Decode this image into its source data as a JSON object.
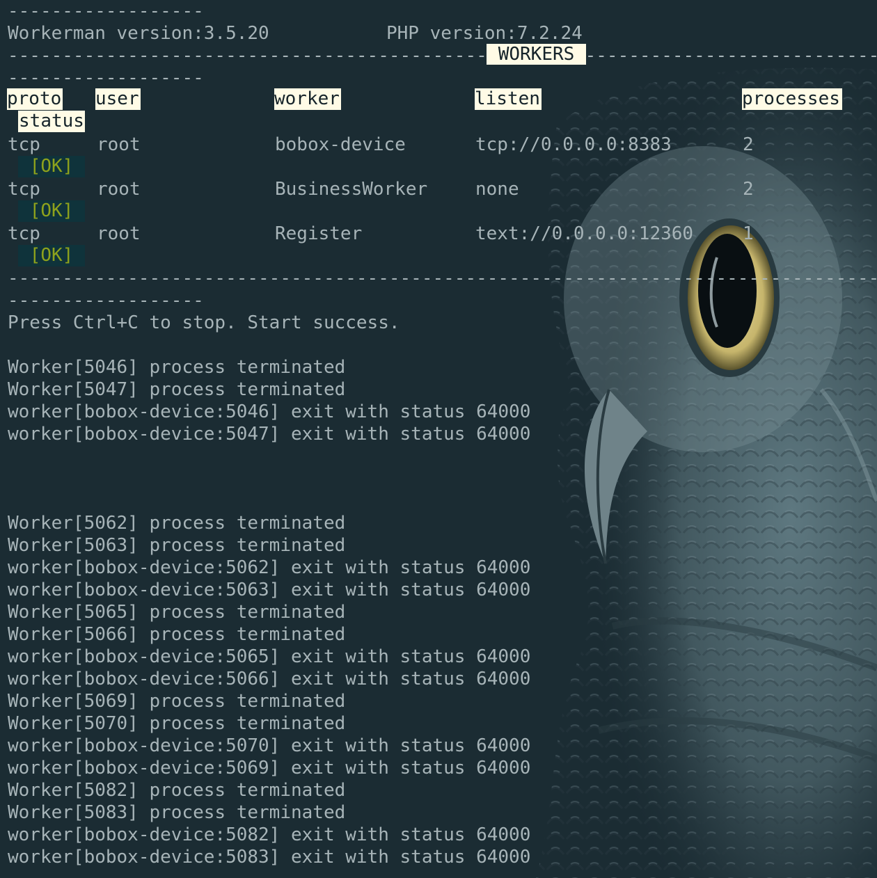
{
  "header": {
    "top_dashes": "------------------",
    "workerman_version": "Workerman version:3.5.20",
    "php_version": "PHP version:7.2.24",
    "workers_title": "WORKERS",
    "after_title_dashes": "------------------"
  },
  "table": {
    "columns": {
      "proto": "proto",
      "user": "user",
      "worker": "worker",
      "listen": "listen",
      "processes": "processes",
      "status": "status"
    },
    "rows": [
      {
        "proto": "tcp",
        "user": "root",
        "worker": "bobox-device",
        "listen": "tcp://0.0.0.0:8383",
        "processes": "2",
        "status": "[OK]"
      },
      {
        "proto": "tcp",
        "user": "root",
        "worker": "BusinessWorker",
        "listen": "none",
        "processes": "2",
        "status": "[OK]"
      },
      {
        "proto": "tcp",
        "user": "root",
        "worker": "Register",
        "listen": "text://0.0.0.0:12360",
        "processes": "1",
        "status": "[OK]"
      }
    ],
    "bottom_dashes": "------------------"
  },
  "start_message": "Press Ctrl+C to stop. Start success.",
  "log_block_1": [
    "Worker[5046] process terminated",
    "Worker[5047] process terminated",
    "worker[bobox-device:5046] exit with status 64000",
    "worker[bobox-device:5047] exit with status 64000"
  ],
  "log_block_2": [
    "Worker[5062] process terminated",
    "Worker[5063] process terminated",
    "worker[bobox-device:5062] exit with status 64000",
    "worker[bobox-device:5063] exit with status 64000",
    "Worker[5065] process terminated",
    "Worker[5066] process terminated",
    "worker[bobox-device:5065] exit with status 64000",
    "worker[bobox-device:5066] exit with status 64000",
    "Worker[5069] process terminated",
    "Worker[5070] process terminated",
    "worker[bobox-device:5070] exit with status 64000",
    "worker[bobox-device:5069] exit with status 64000",
    "Worker[5082] process terminated",
    "Worker[5083] process terminated",
    "worker[bobox-device:5082] exit with status 64000",
    "worker[bobox-device:5083] exit with status 64000"
  ],
  "colors": {
    "background": "#1b2c33",
    "text": "#a7b4b8",
    "highlight_bg": "#fffbe6",
    "highlight_text": "#152329",
    "ok_bg": "#0f333b",
    "ok_text": "#8ea21c"
  },
  "background_image": "owl-photo"
}
